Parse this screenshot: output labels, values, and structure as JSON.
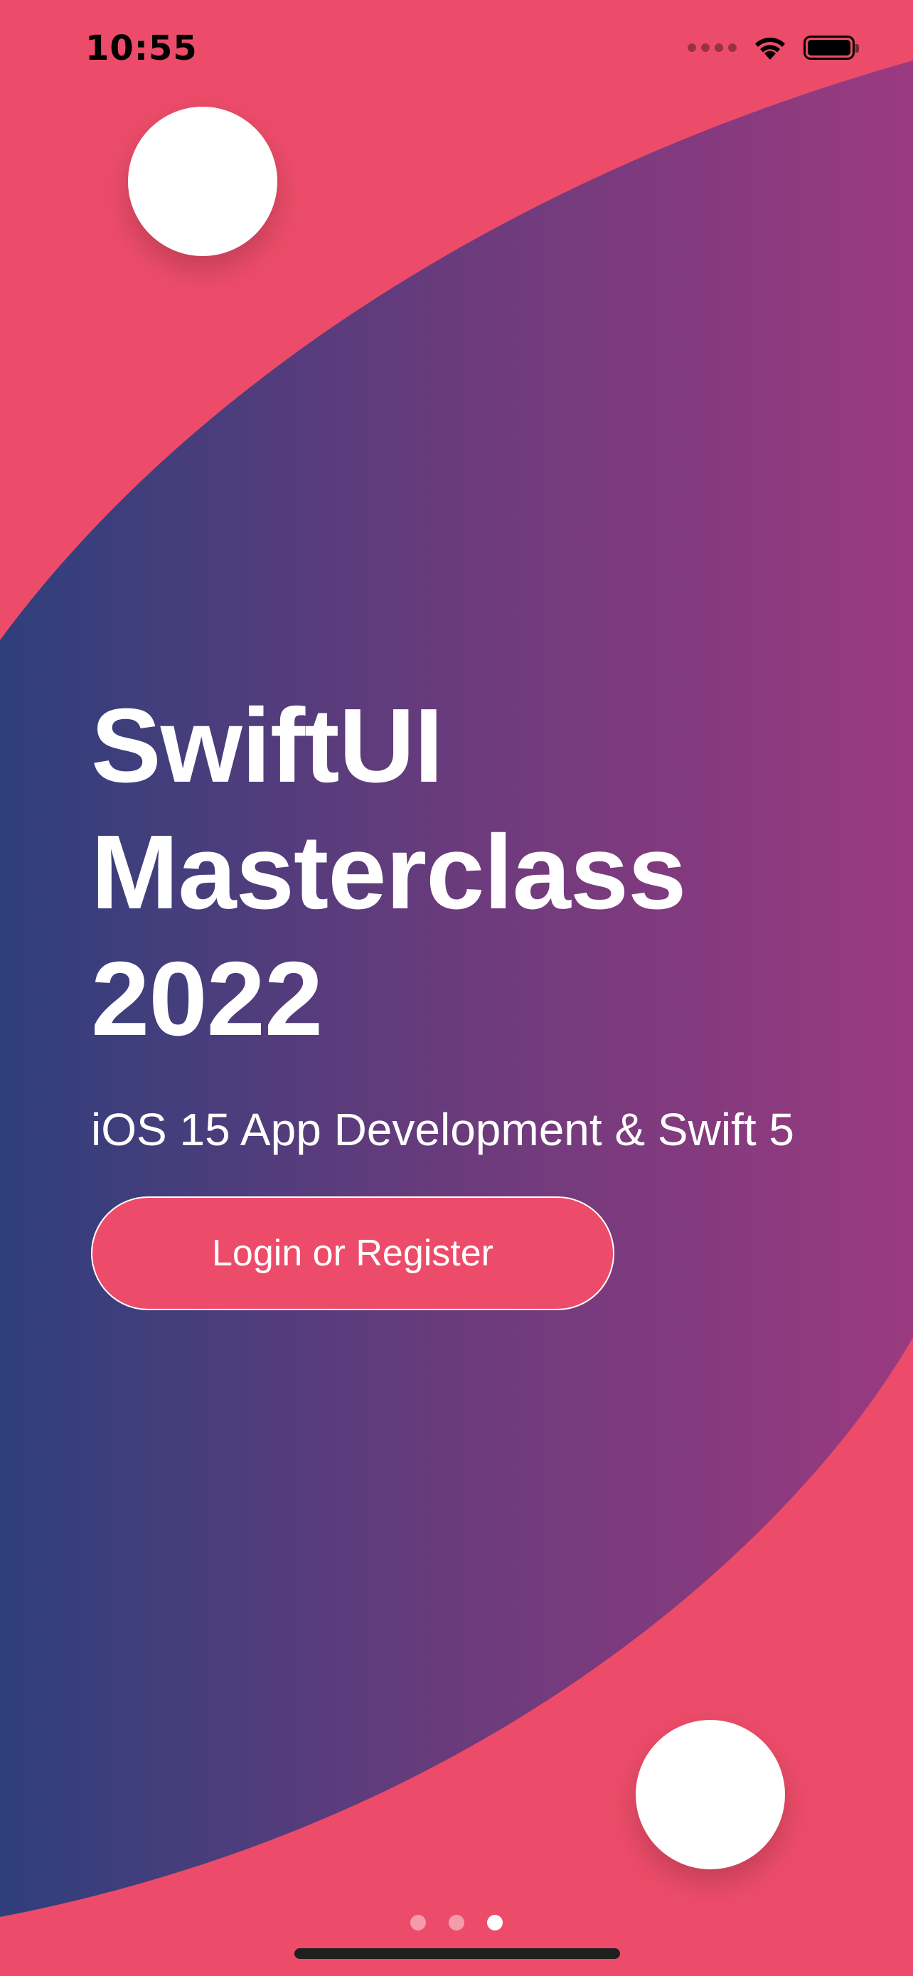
{
  "status_bar": {
    "time": "10:55",
    "icons": [
      "signal-dots-icon",
      "wifi-icon",
      "battery-icon"
    ]
  },
  "hero": {
    "title": "SwiftUI\nMasterclass\n2022",
    "subtitle": "iOS 15 App Development & Swift 5",
    "button_label": "Login or Register"
  },
  "pagination": {
    "total_pages": 3,
    "current_page": 3
  },
  "colors": {
    "background": "#EC4C69",
    "gradient_start": "#2E3F7C",
    "gradient_end": "#9B3A80",
    "text": "#FFFFFF"
  }
}
